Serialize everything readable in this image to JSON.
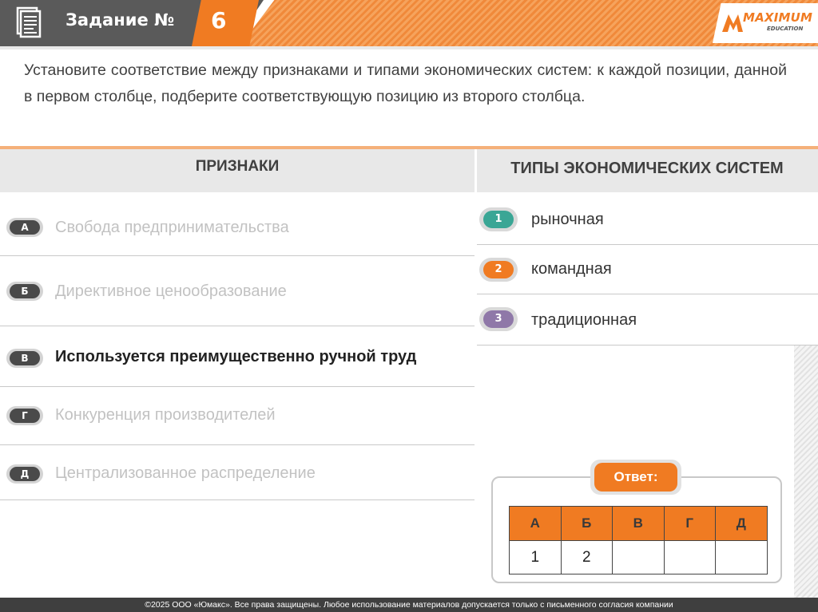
{
  "header": {
    "task_label": "Задание №",
    "task_number": "6",
    "logo_text": "MAXIMUM",
    "logo_sub": "EDUCATION",
    "icons": [
      "document-icon",
      "maximum-logo-icon"
    ]
  },
  "question": {
    "text": "Установите соответствие между признаками и типами экономических систем: к каждой позиции, данной в первом столбце, подберите соответствующую позицию из второго столбца."
  },
  "columns": {
    "left_title": "ПРИЗНАКИ",
    "right_title": "ТИПЫ ЭКОНОМИЧЕСКИХ СИСТЕМ"
  },
  "features": [
    {
      "letter": "А",
      "text": "Свобода предпринимательства",
      "active": false
    },
    {
      "letter": "Б",
      "text": "Директивное ценообразование",
      "active": false
    },
    {
      "letter": "В",
      "text": "Используется преимущественно ручной труд",
      "active": true
    },
    {
      "letter": "Г",
      "text": "Конкуренция производителей",
      "active": false
    },
    {
      "letter": "Д",
      "text": "Централизованное распределение",
      "active": false
    }
  ],
  "types": [
    {
      "num": "1",
      "text": "рыночная",
      "color": "#3aa695"
    },
    {
      "num": "2",
      "text": "командная",
      "color": "#f07b22"
    },
    {
      "num": "3",
      "text": "традиционная",
      "color": "#8f78a8"
    }
  ],
  "answer": {
    "label": "Ответ:",
    "headers": [
      "А",
      "Б",
      "В",
      "Г",
      "Д"
    ],
    "values": [
      "1",
      "2",
      "",
      "",
      ""
    ]
  },
  "colors": {
    "accent": "#f07b22",
    "header_gray": "#5a5a5a"
  },
  "footer": {
    "text": "©2025 ООО «Юмакс». Все права защищены. Любое использование материалов допускается только с письменного согласия компании"
  }
}
